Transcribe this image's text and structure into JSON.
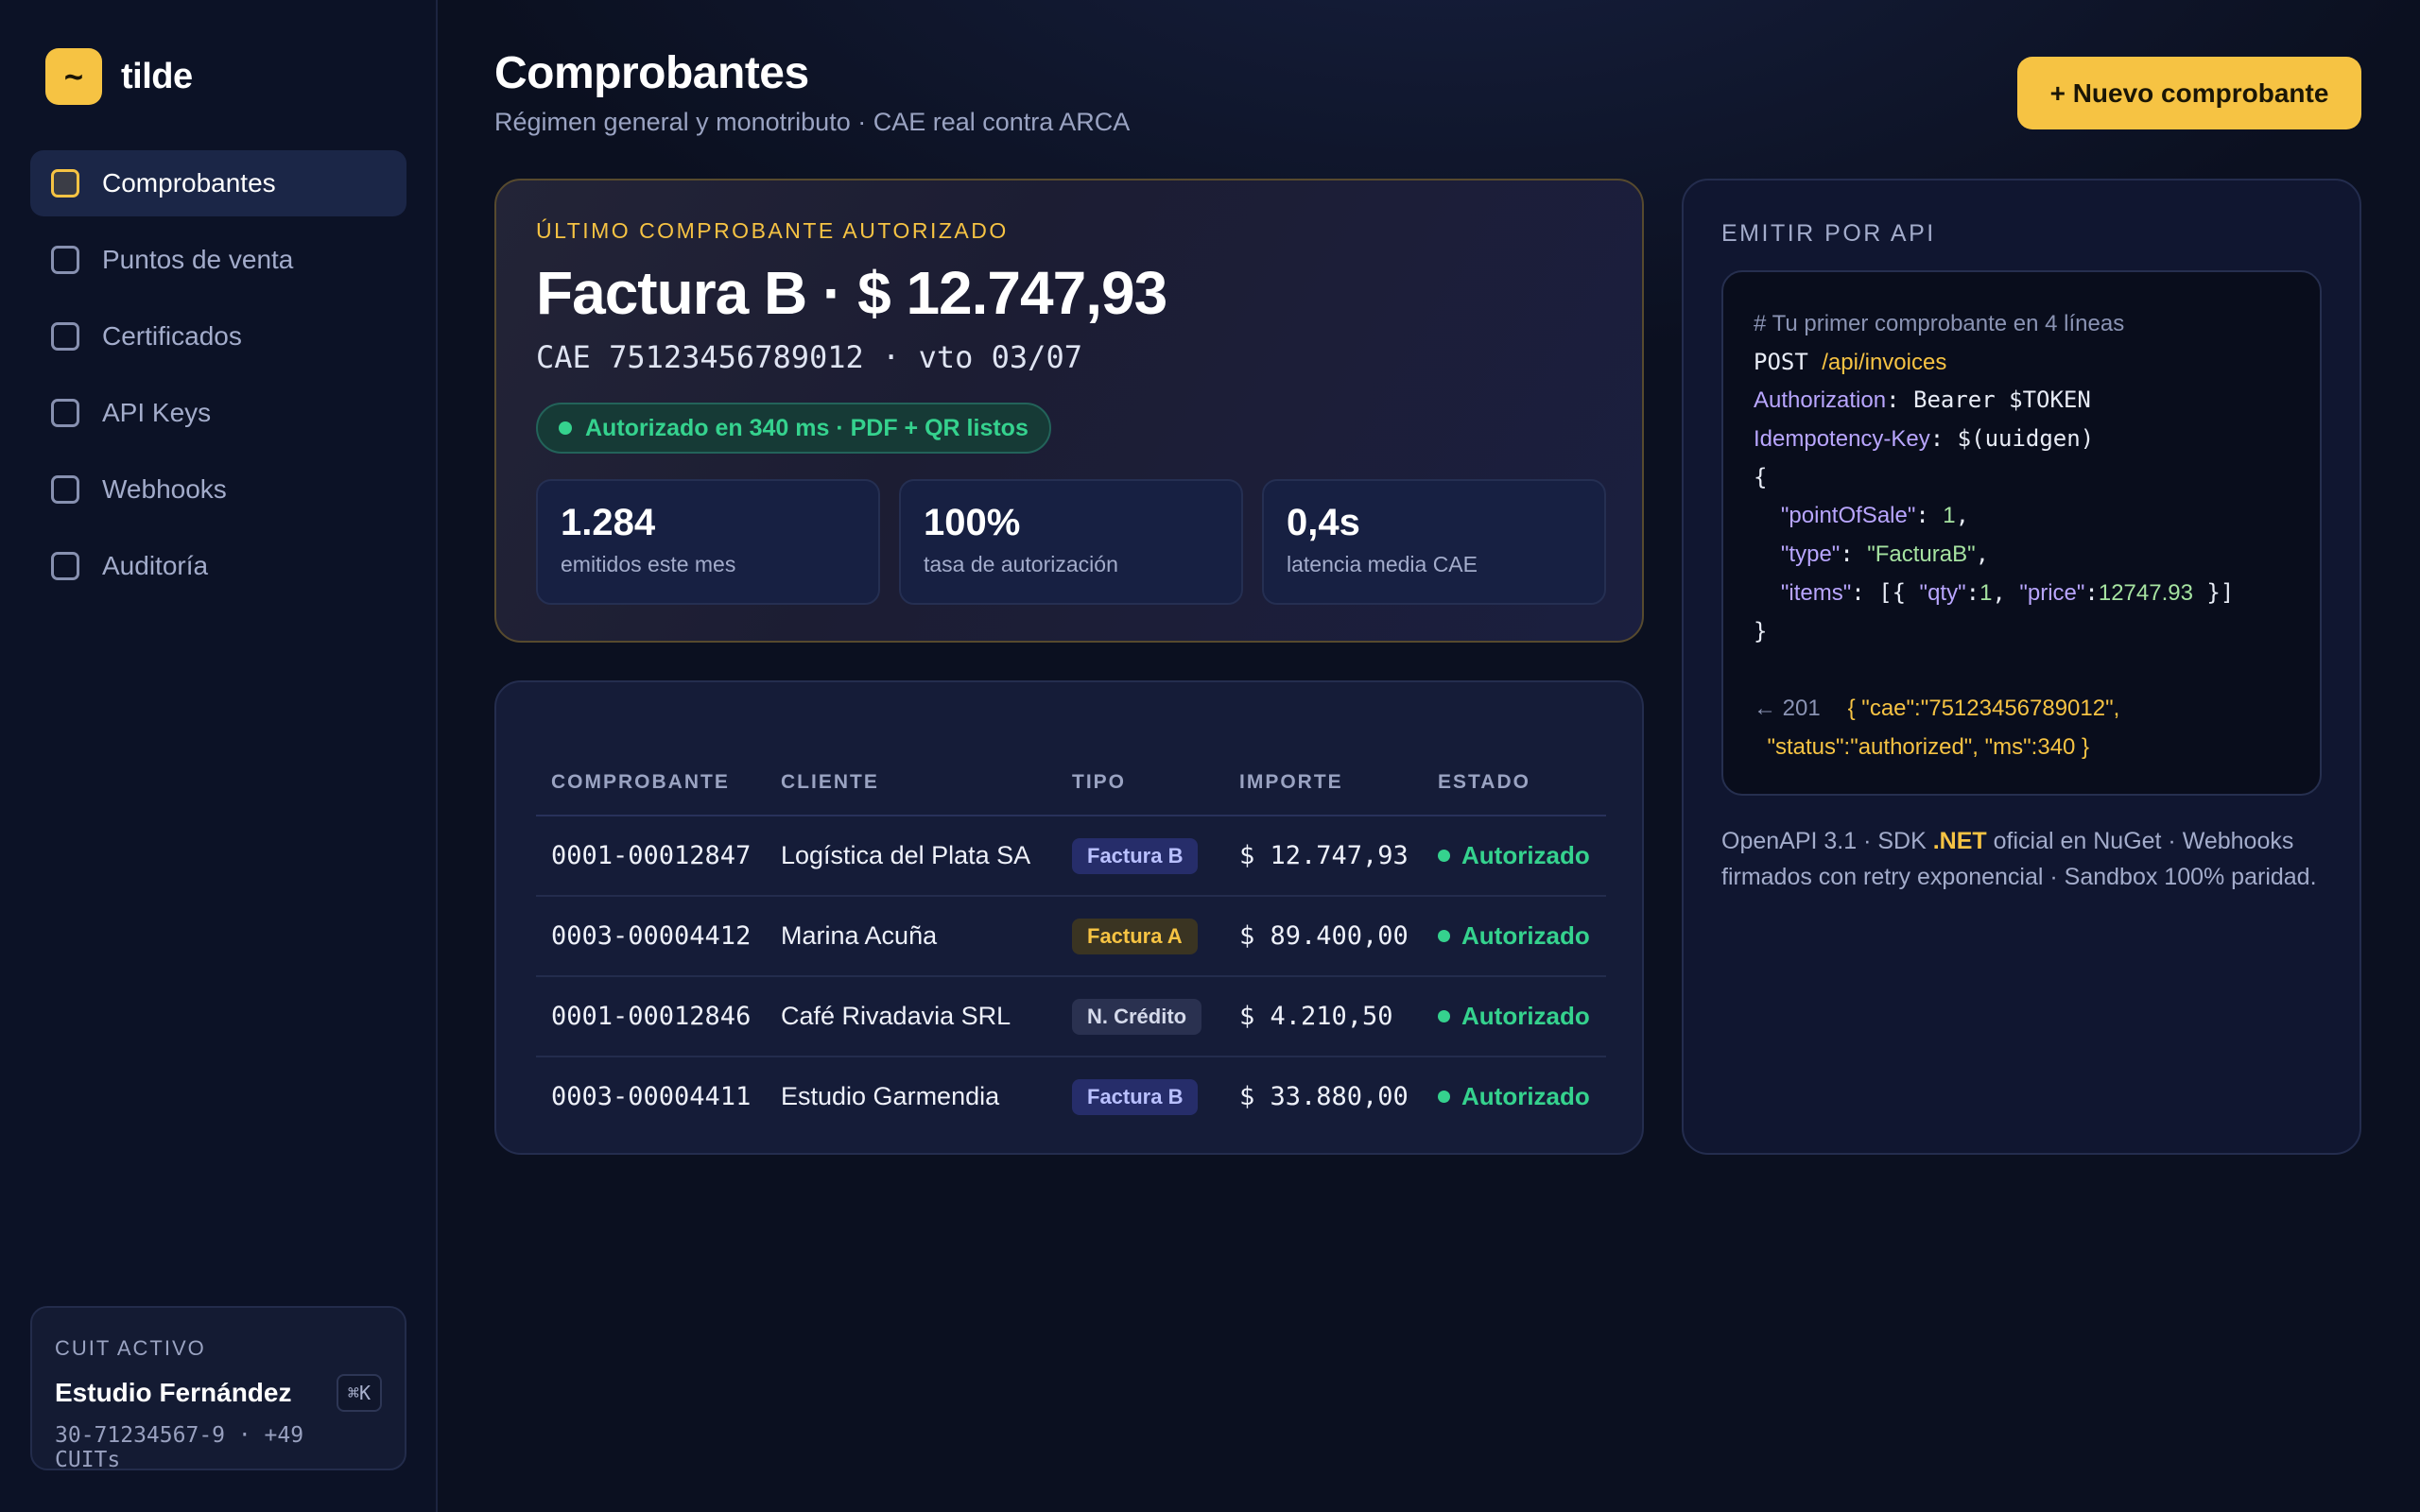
{
  "brand": {
    "logo": "~",
    "name": "tilde"
  },
  "sidebar": {
    "items": [
      {
        "label": "Comprobantes",
        "active": true
      },
      {
        "label": "Puntos de venta",
        "active": false
      },
      {
        "label": "Certificados",
        "active": false
      },
      {
        "label": "API Keys",
        "active": false
      },
      {
        "label": "Webhooks",
        "active": false
      },
      {
        "label": "Auditoría",
        "active": false
      }
    ],
    "cuit": {
      "label": "CUIT ACTIVO",
      "name": "Estudio Fernández",
      "shortcut": "⌘K",
      "number": "30-71234567-9 · +49 CUITs"
    }
  },
  "header": {
    "title": "Comprobantes",
    "subtitle": "Régimen general y monotributo · CAE real contra ARCA",
    "new_button": "+ Nuevo comprobante"
  },
  "hero": {
    "eyebrow": "ÚLTIMO COMPROBANTE AUTORIZADO",
    "title": "Factura B · $ 12.747,93",
    "cae": "CAE 75123456789012 · vto 03/07",
    "pill": "Autorizado en 340 ms · PDF + QR listos",
    "stats": [
      {
        "value": "1.284",
        "label": "emitidos este mes"
      },
      {
        "value": "100%",
        "label": "tasa de autorización"
      },
      {
        "value": "0,4s",
        "label": "latencia media CAE"
      }
    ]
  },
  "table": {
    "headers": [
      "COMPROBANTE",
      "CLIENTE",
      "TIPO",
      "IMPORTE",
      "ESTADO"
    ],
    "rows": [
      {
        "number": "0001-00012847",
        "client": "Logística del Plata SA",
        "type": "Factura B",
        "amount": "$ 12.747,93",
        "status": "Autorizado"
      },
      {
        "number": "0003-00004412",
        "client": "Marina Acuña",
        "type": "Factura A",
        "amount": "$ 89.400,00",
        "status": "Autorizado"
      },
      {
        "number": "0001-00012846",
        "client": "Café Rivadavia SRL",
        "type": "N. Crédito",
        "amount": "$ 4.210,50",
        "status": "Autorizado"
      },
      {
        "number": "0003-00004411",
        "client": "Estudio Garmendia",
        "type": "Factura B",
        "amount": "$ 33.880,00",
        "status": "Autorizado"
      }
    ]
  },
  "api": {
    "title": "EMITIR POR API",
    "code": {
      "comment": "# Tu primer comprobante en 4 líneas",
      "method": "POST",
      "url": "/api/invoices",
      "auth_key": "Authorization",
      "auth_val": ": Bearer $TOKEN",
      "idem_key": "Idempotency-Key",
      "idem_val": ": $(uuidgen)",
      "open_brace": "{",
      "pos_key": "\"pointOfSale\"",
      "pos_val": "1",
      "type_key": "\"type\"",
      "type_val": "\"FacturaB\"",
      "items_key": "\"items\"",
      "items_open": ": [{ ",
      "qty_key": "\"qty\"",
      "qty_val": "1",
      "price_key": "\"price\"",
      "price_val": "12747.93",
      "items_close": " }]",
      "close_brace": "}",
      "resp_arrow": "← 201",
      "resp_line1": "{ \"cae\":\"75123456789012\",",
      "resp_line2": "\"status\":\"authorized\", \"ms\":340 }"
    },
    "footer_pre": "OpenAPI 3.1 · SDK ",
    "footer_hl": ".NET",
    "footer_post": " oficial en NuGet · Webhooks firmados con retry exponencial · Sandbox 100% paridad."
  },
  "colors": {
    "accent": "#f6c343",
    "success": "#35d28e",
    "background": "#0b1020"
  }
}
